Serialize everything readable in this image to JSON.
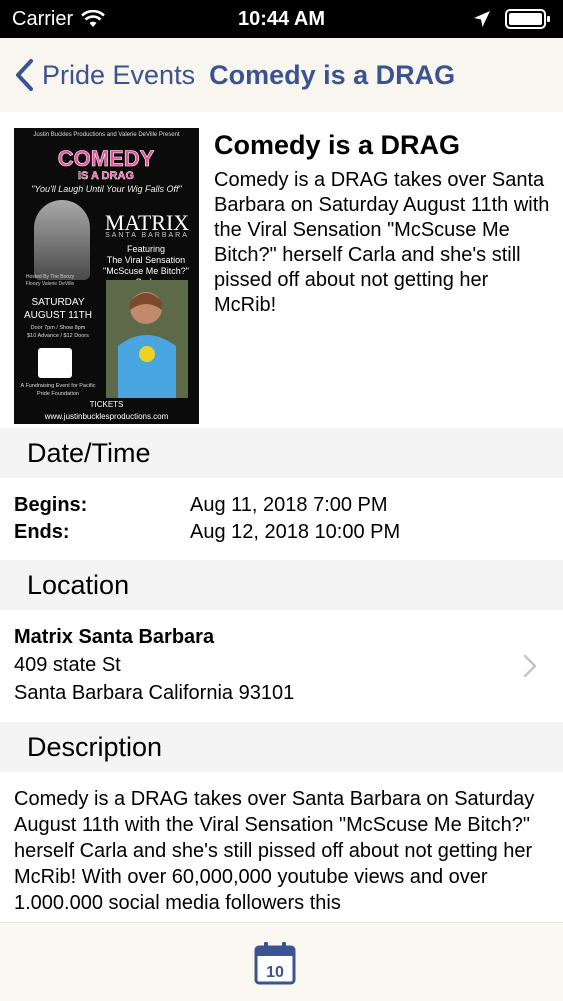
{
  "status_bar": {
    "carrier": "Carrier",
    "time": "10:44 AM"
  },
  "nav": {
    "back_label": "Pride Events",
    "title": "Comedy is a DRAG"
  },
  "event": {
    "title": "Comedy is a DRAG",
    "summary": "Comedy is a DRAG takes over Santa Barbara on Saturday August 11th with the Viral Sensation \"McScuse Me Bitch?\" herself Carla and she's still pissed off about not getting her McRib!"
  },
  "poster": {
    "top_line": "Justin Buckles Productions and Valerie DeVille Present",
    "logo_line1": "COMEDY",
    "logo_line2": "IS A DRAG",
    "tagline": "\"You'll Laugh Until Your Wig Falls Off\"",
    "venue": "MATRIX",
    "venue_sub": "SANTA BARBARA",
    "featuring": "Featuring",
    "feat_line": "The Viral Sensation",
    "feat_quote": "\"McScuse Me Bitch?\" Carla",
    "hosted": "Hosted By The Boozy Floozy Valerie DeVille",
    "date_day": "SATURDAY",
    "date_date": "AUGUST 11TH",
    "doors": "Door 7pm / Show 8pm",
    "prices": "$10 Advance / $12 Doors",
    "fundraiser": "A Fundraising Event for Pacific Pride Foundation",
    "tickets": "TICKETS",
    "url": "www.justinbucklesproductions.com"
  },
  "sections": {
    "date_time": "Date/Time",
    "location": "Location",
    "description": "Description"
  },
  "dates": {
    "begins_label": "Begins:",
    "begins_value": "Aug 11, 2018 7:00 PM",
    "ends_label": "Ends:",
    "ends_value": "Aug 12, 2018 10:00 PM"
  },
  "location": {
    "name": "Matrix Santa Barbara",
    "street": "409 state St",
    "city": "Santa Barbara California 93101"
  },
  "description": {
    "text": "Comedy is a DRAG takes over Santa Barbara on Saturday August 11th with the Viral Sensation \"McScuse Me Bitch?\" herself Carla and she's still pissed off about not getting her McRib! With over 60,000,000 youtube views and over 1.000.000 social media followers this"
  },
  "tab_bar": {
    "calendar_day": "10"
  },
  "colors": {
    "accent": "#3b5390",
    "section_bg": "#f4f4f4",
    "nav_bg": "#f8f6ef"
  }
}
